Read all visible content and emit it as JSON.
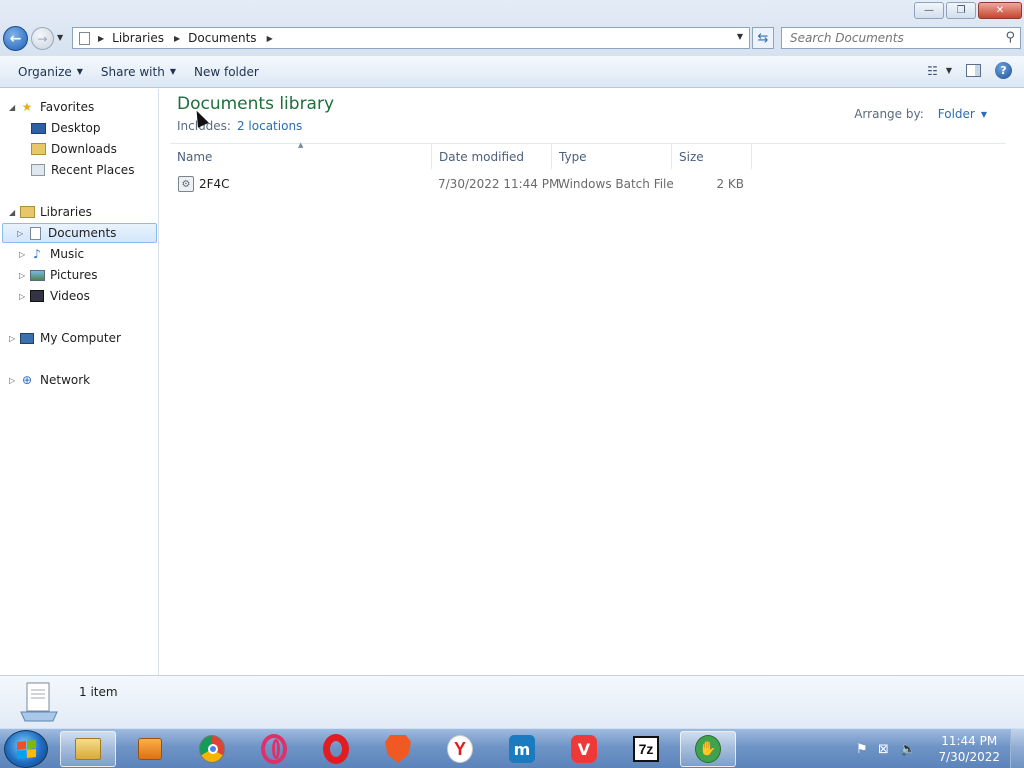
{
  "window": {
    "buttons": {
      "minimize": "—",
      "maximize": "❐",
      "close": "✕"
    }
  },
  "address": {
    "crumbs": [
      "Libraries",
      "Documents"
    ],
    "search_placeholder": "Search Documents"
  },
  "commands": {
    "organize": "Organize",
    "share_with": "Share with",
    "new_folder": "New folder"
  },
  "nav": {
    "favorites": "Favorites",
    "desktop": "Desktop",
    "downloads": "Downloads",
    "recent_places": "Recent Places",
    "libraries": "Libraries",
    "documents": "Documents",
    "music": "Music",
    "pictures": "Pictures",
    "videos": "Videos",
    "my_computer": "My Computer",
    "network": "Network"
  },
  "library": {
    "title": "Documents library",
    "includes_label": "Includes:",
    "includes_link": "2 locations",
    "arrange_label": "Arrange by:",
    "arrange_value": "Folder"
  },
  "columns": {
    "name": "Name",
    "date": "Date modified",
    "type": "Type",
    "size": "Size"
  },
  "files": [
    {
      "name": "2F4C",
      "date": "7/30/2022 11:44 PM",
      "type": "Windows Batch File",
      "size": "2 KB"
    }
  ],
  "details": {
    "count": "1 item"
  },
  "taskbar": {
    "apps": [
      "explorer",
      "media-player",
      "chrome",
      "opera-outline",
      "opera",
      "brave",
      "yandex",
      "maxthon",
      "vivaldi",
      "7zip",
      "handshake"
    ],
    "time": "11:44 PM",
    "date": "7/30/2022"
  },
  "colors": {
    "title_green": "#1e6e3a",
    "link_blue": "#2c6bb8",
    "taskbar_blue": "#6f94c6"
  }
}
